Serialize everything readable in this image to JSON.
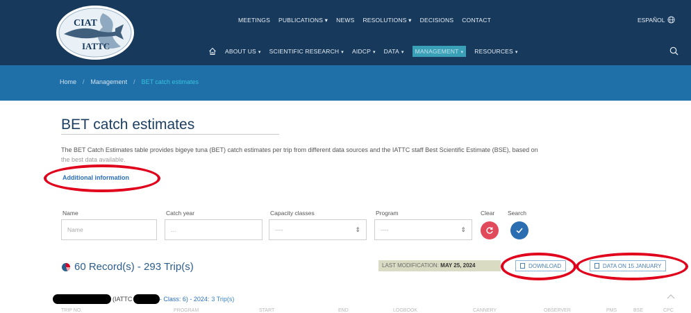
{
  "logo": {
    "top_text": "CIAT",
    "bottom_text": "IATTC"
  },
  "nav_top": [
    "MEETINGS",
    "PUBLICATIONS ▾",
    "NEWS",
    "RESOLUTIONS ▾",
    "DECISIONS",
    "CONTACT"
  ],
  "nav_bottom": {
    "about": "ABOUT US",
    "science": "SCIENTIFIC RESEARCH",
    "aidcp": "AIDCP",
    "data": "DATA",
    "management": "MANAGEMENT",
    "resources": "RESOURCES"
  },
  "language": "ESPAÑOL",
  "breadcrumb": {
    "home": "Home",
    "section": "Management",
    "current": "BET catch estimates"
  },
  "page": {
    "title": "BET catch estimates",
    "intro_line1": "The BET Catch Estimates table provides bigeye tuna (BET) catch estimates per trip from different data sources and the IATTC staff Best Scientific Estimate (BSE), based on",
    "intro_line2": "the best data available.",
    "more_info": "Additional information"
  },
  "filters": {
    "name_label": "Name",
    "name_placeholder": "Name",
    "year_label": "Catch year",
    "year_value": "...",
    "capacity_label": "Capacity classes",
    "capacity_value": "----",
    "program_label": "Program",
    "program_value": "----",
    "clear_label": "Clear",
    "search_label": "Search"
  },
  "summary": {
    "records": "60 Record(s) - 293 Trip(s)",
    "last_mod_label": "LAST MODIFICATION:",
    "last_mod_date": "MAY 25, 2024",
    "download": "DOWNLOAD",
    "data_on": "DATA ON 15 JANUARY"
  },
  "group": {
    "org": "(IATTC #",
    "class_year": "- Class: 6) - 2024:",
    "trips": "3 Trip(s)"
  },
  "columns": [
    "TRIP NO.",
    "PROGRAM",
    "START",
    "END",
    "LOGBOOK",
    "CANNERY",
    "OBSERVER",
    "PMS",
    "BSE",
    "CPC"
  ],
  "colors": {
    "header": "#16395c",
    "crumb_bar": "#1f6fa8",
    "active": "#3aa0b8",
    "annotation": "#e0001b"
  }
}
